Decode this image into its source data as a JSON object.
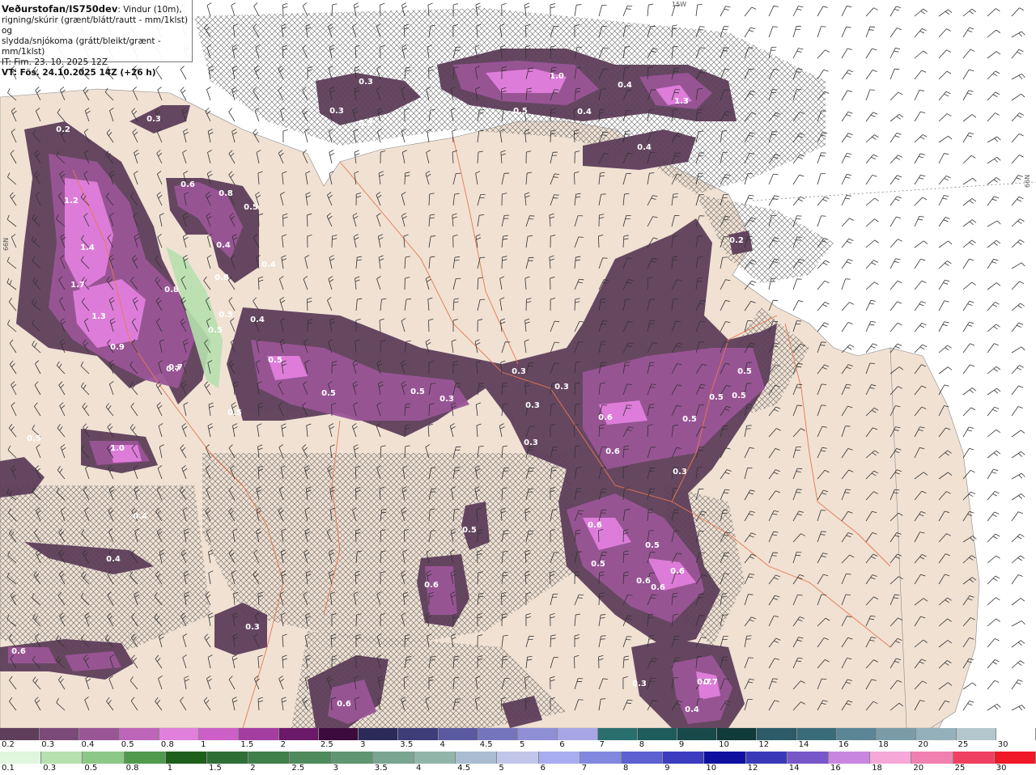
{
  "header": {
    "title": "Veðurstofan/IS750dev",
    "title_suffix": ": Vindur (10m),",
    "line2": "rigning/skúrir (grænt/blátt/rautt - mm/1klst) og",
    "line3": "slydda/snjókoma (grátt/bleikt/grænt - mm/1klst)",
    "issue_time": "IT: Fim. 23. 10. 2025 12Z",
    "valid_time": "VT: Fös. 24.10.2025 14Z (+26 h)"
  },
  "map_labels": {
    "top_edge": "15W",
    "right_edge": "66N",
    "left_edge": "66N"
  },
  "contour_labels": [
    {
      "text": "0.3"
    },
    {
      "text": "0.3"
    },
    {
      "text": "0.3"
    },
    {
      "text": "0.2"
    },
    {
      "text": "0.3"
    },
    {
      "text": "1.0"
    },
    {
      "text": "0.4"
    },
    {
      "text": "0.5"
    },
    {
      "text": "0.4"
    },
    {
      "text": "1.3"
    },
    {
      "text": "0.4"
    },
    {
      "text": "0.6"
    },
    {
      "text": "0.8"
    },
    {
      "text": "0.5"
    },
    {
      "text": "1.2"
    },
    {
      "text": "1.4"
    },
    {
      "text": "1.7"
    },
    {
      "text": "1.3"
    },
    {
      "text": "0.9"
    },
    {
      "text": "0.4"
    },
    {
      "text": "0.8"
    },
    {
      "text": "0.5"
    },
    {
      "text": "0.4"
    },
    {
      "text": "0.5"
    },
    {
      "text": "0.5"
    },
    {
      "text": "0.5"
    },
    {
      "text": "0.5"
    },
    {
      "text": "0.3"
    },
    {
      "text": "0.3"
    },
    {
      "text": "0.3"
    },
    {
      "text": "0.3"
    },
    {
      "text": "0.3"
    },
    {
      "text": "0.5"
    },
    {
      "text": "0.5"
    },
    {
      "text": "0.5"
    },
    {
      "text": "0.6"
    },
    {
      "text": "0.5"
    },
    {
      "text": "0.6"
    },
    {
      "text": "0.3"
    },
    {
      "text": "0.6"
    },
    {
      "text": "0.5"
    },
    {
      "text": "0.5"
    },
    {
      "text": "0.6"
    },
    {
      "text": "0.6"
    },
    {
      "text": "0.7"
    },
    {
      "text": "0.6"
    },
    {
      "text": "0.3"
    },
    {
      "text": "0.6"
    },
    {
      "text": "0.6"
    },
    {
      "text": "0.5"
    },
    {
      "text": "0.7"
    },
    {
      "text": "0.4"
    },
    {
      "text": "0.3"
    },
    {
      "text": "0.2"
    },
    {
      "text": "1.0"
    },
    {
      "text": "0.4"
    },
    {
      "text": "0.4"
    },
    {
      "text": "0.5"
    },
    {
      "text": "0.6"
    },
    {
      "text": "0.7"
    },
    {
      "text": "0.8"
    },
    {
      "text": "0.7"
    },
    {
      "text": "0.5"
    },
    {
      "text": "0.4"
    }
  ],
  "legend_snow": {
    "labels": [
      "0.2",
      "0.3",
      "0.4",
      "0.5",
      "0.8",
      "1",
      "1.5",
      "2",
      "2.5",
      "3",
      "3.5",
      "4",
      "4.5",
      "5",
      "6",
      "7",
      "8",
      "9",
      "10",
      "12",
      "14",
      "16",
      "18",
      "20",
      "25",
      "30"
    ],
    "colors": [
      "#5e3e5a",
      "#7b4a78",
      "#9a5596",
      "#bd65b8",
      "#e07fdc",
      "#cc5fc8",
      "#a43ea1",
      "#6a1a68",
      "#3d0a3d",
      "#2b2b5a",
      "#3d3d7a",
      "#5a5aa0",
      "#7575be",
      "#8f8fd6",
      "#a6a6e6",
      "#2a6f6f",
      "#1f5c5c",
      "#184a4a",
      "#113a3a",
      "#2d5b68",
      "#3a6b78",
      "#5a8595",
      "#7a9ca8",
      "#94b0ba",
      "#b4c7cd",
      "#ffffff"
    ]
  },
  "legend_rain": {
    "labels": [
      "0.1",
      "0.3",
      "0.5",
      "0.8",
      "1",
      "1.5",
      "2",
      "2.5",
      "3",
      "3.5",
      "4",
      "4.5",
      "5",
      "6",
      "7",
      "8",
      "9",
      "10",
      "12",
      "14",
      "16",
      "18",
      "20",
      "25",
      "30"
    ],
    "colors": [
      "#e0f6dd",
      "#b6e0ae",
      "#8cc886",
      "#4f9a4c",
      "#1f5f1c",
      "#2f6f36",
      "#3f7f4a",
      "#4f8a5c",
      "#5f9570",
      "#7aa590",
      "#92b5aa",
      "#aabdd0",
      "#c1c6e8",
      "#a8acf0",
      "#8288e0",
      "#5c60d0",
      "#3c3cc0",
      "#1010a0",
      "#3a3ab8",
      "#7858c8",
      "#c886e0",
      "#f6a8d8",
      "#f080b0",
      "#f04060",
      "#f01828"
    ]
  }
}
